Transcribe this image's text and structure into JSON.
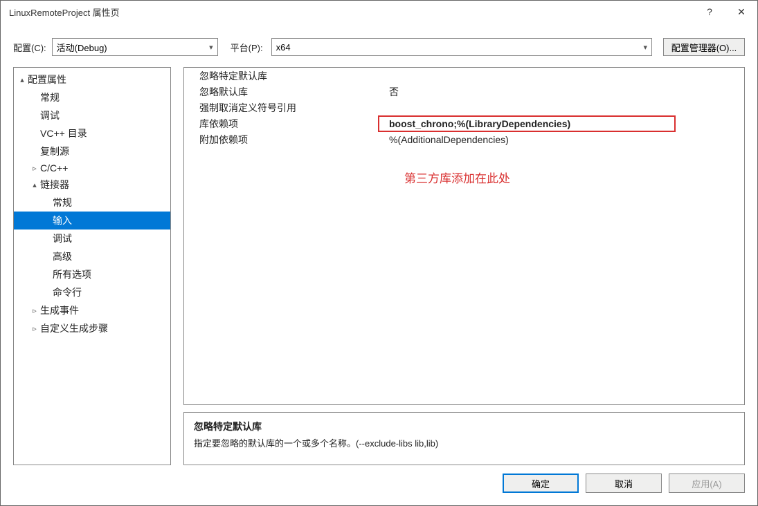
{
  "title": "LinuxRemoteProject 属性页",
  "help_glyph": "?",
  "close_glyph": "✕",
  "toolbar": {
    "config_label": "配置(C):",
    "config_value": "活动(Debug)",
    "platform_label": "平台(P):",
    "platform_value": "x64",
    "config_manager": "配置管理器(O)..."
  },
  "tree": [
    {
      "label": "配置属性",
      "depth": 0,
      "exp": "▴"
    },
    {
      "label": "常规",
      "depth": 1,
      "exp": ""
    },
    {
      "label": "调试",
      "depth": 1,
      "exp": ""
    },
    {
      "label": "VC++ 目录",
      "depth": 1,
      "exp": ""
    },
    {
      "label": "复制源",
      "depth": 1,
      "exp": ""
    },
    {
      "label": "C/C++",
      "depth": 1,
      "exp": "▹"
    },
    {
      "label": "链接器",
      "depth": 1,
      "exp": "▴",
      "children_selected": true
    },
    {
      "label": "常规",
      "depth": 2,
      "exp": ""
    },
    {
      "label": "输入",
      "depth": 2,
      "exp": "",
      "selected": true
    },
    {
      "label": "调试",
      "depth": 2,
      "exp": ""
    },
    {
      "label": "高级",
      "depth": 2,
      "exp": ""
    },
    {
      "label": "所有选项",
      "depth": 2,
      "exp": ""
    },
    {
      "label": "命令行",
      "depth": 2,
      "exp": ""
    },
    {
      "label": "生成事件",
      "depth": 1,
      "exp": "▹"
    },
    {
      "label": "自定义生成步骤",
      "depth": 1,
      "exp": "▹"
    }
  ],
  "grid": [
    {
      "k": "忽略特定默认库",
      "v": ""
    },
    {
      "k": "忽略默认库",
      "v": "否"
    },
    {
      "k": "强制取消定义符号引用",
      "v": ""
    },
    {
      "k": "库依赖项",
      "v": "boost_chrono;%(LibraryDependencies)",
      "highlight": true
    },
    {
      "k": "附加依赖项",
      "v": "%(AdditionalDependencies)"
    }
  ],
  "annotation": "第三方库添加在此处",
  "desc": {
    "title": "忽略特定默认库",
    "sub": "指定要忽略的默认库的一个或多个名称。(--exclude-libs lib,lib)"
  },
  "footer": {
    "ok": "确定",
    "cancel": "取消",
    "apply": "应用(A)"
  }
}
